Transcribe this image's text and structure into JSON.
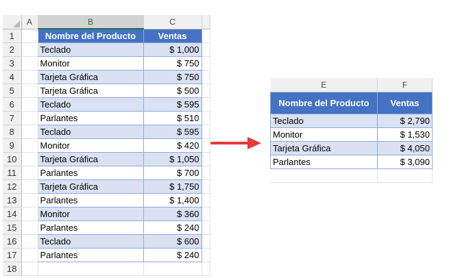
{
  "left_sheet": {
    "col_headers": [
      "A",
      "B",
      "C"
    ],
    "row_numbers": [
      "1",
      "2",
      "3",
      "4",
      "5",
      "6",
      "7",
      "8",
      "9",
      "10",
      "11",
      "12",
      "13",
      "14",
      "15",
      "16",
      "17",
      "18"
    ],
    "header_product": "Nombre del Producto",
    "header_sales": "Ventas",
    "rows": [
      {
        "product": "Teclado",
        "currency": "$",
        "sales": "1,000"
      },
      {
        "product": "Monitor",
        "currency": "$",
        "sales": "750"
      },
      {
        "product": "Tarjeta Gráfica",
        "currency": "$",
        "sales": "750"
      },
      {
        "product": "Tarjeta Gráfica",
        "currency": "$",
        "sales": "500"
      },
      {
        "product": "Teclado",
        "currency": "$",
        "sales": "595"
      },
      {
        "product": "Parlantes",
        "currency": "$",
        "sales": "510"
      },
      {
        "product": "Teclado",
        "currency": "$",
        "sales": "595"
      },
      {
        "product": "Monitor",
        "currency": "$",
        "sales": "420"
      },
      {
        "product": "Tarjeta Gráfica",
        "currency": "$",
        "sales": "1,050"
      },
      {
        "product": "Parlantes",
        "currency": "$",
        "sales": "700"
      },
      {
        "product": "Tarjeta Gráfica",
        "currency": "$",
        "sales": "1,750"
      },
      {
        "product": "Parlantes",
        "currency": "$",
        "sales": "1,400"
      },
      {
        "product": "Monitor",
        "currency": "$",
        "sales": "360"
      },
      {
        "product": "Parlantes",
        "currency": "$",
        "sales": "240"
      },
      {
        "product": "Teclado",
        "currency": "$",
        "sales": "600"
      },
      {
        "product": "Parlantes",
        "currency": "$",
        "sales": "240"
      }
    ]
  },
  "right_sheet": {
    "col_headers": [
      "E",
      "F"
    ],
    "header_product": "Nombre del Producto",
    "header_sales": "Ventas",
    "rows": [
      {
        "product": "Teclado",
        "currency": "$",
        "sales": "2,790"
      },
      {
        "product": "Monitor",
        "currency": "$",
        "sales": "1,530"
      },
      {
        "product": "Tarjeta Gráfica",
        "currency": "$",
        "sales": "4,050"
      },
      {
        "product": "Parlantes",
        "currency": "$",
        "sales": "3,090"
      }
    ]
  },
  "colors": {
    "header_fill": "#4472c4",
    "band_fill": "#d9e1f2",
    "arrow": "#e53935",
    "selected_column": "#217346"
  },
  "icons": {
    "arrow": "right-arrow-icon"
  }
}
